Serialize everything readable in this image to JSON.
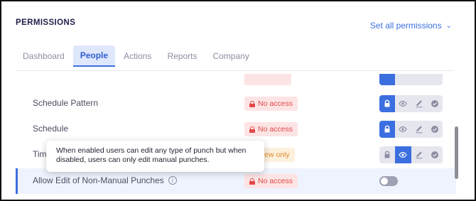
{
  "header": {
    "title": "PERMISSIONS",
    "set_all_label": "Set all permissions",
    "set_all_icon": "chevron-down-icon"
  },
  "tabs": [
    {
      "label": "Dashboard",
      "active": false
    },
    {
      "label": "People",
      "active": true
    },
    {
      "label": "Actions",
      "active": false
    },
    {
      "label": "Reports",
      "active": false
    },
    {
      "label": "Company",
      "active": false
    }
  ],
  "rows": [
    {
      "label": "Schedule Pattern",
      "status": "No access",
      "selected_level": "no-access"
    },
    {
      "label": "Schedule",
      "status": "No access",
      "selected_level": "no-access"
    },
    {
      "label": "Time",
      "status": "View only",
      "selected_level": "view"
    },
    {
      "label": "Allow Edit of Non-Manual Punches",
      "status": "No access",
      "toggle_on": false,
      "highlighted": true
    }
  ],
  "permission_levels": [
    "lock-icon",
    "eye-icon",
    "pencil-icon",
    "check-icon"
  ],
  "tooltip": {
    "text": "When enabled users can edit any type of punch but when disabled, users can only edit manual punches."
  },
  "colors": {
    "accent": "#3b6fe0",
    "no_access_bg": "#fde4e4",
    "no_access_text": "#e04848",
    "view_only_bg": "#fdf0dc",
    "view_only_text": "#e08a2a",
    "title": "#1f1f4a"
  }
}
